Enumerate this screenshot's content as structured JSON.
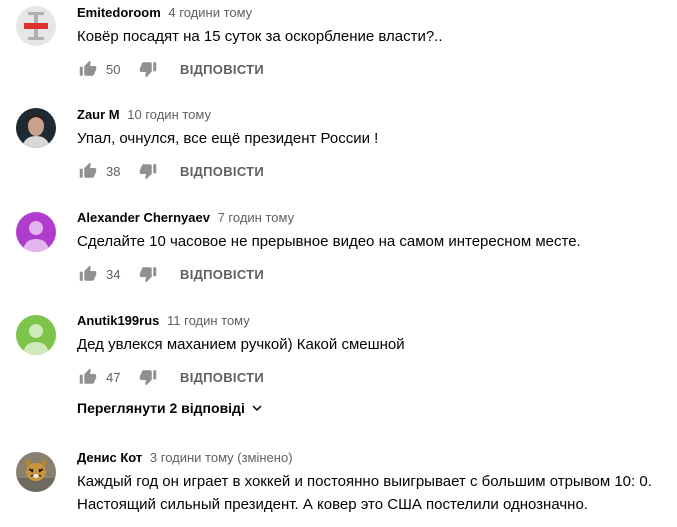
{
  "comments": [
    {
      "author": "Emitedoroom",
      "time": "4 години тому",
      "text": "Ковёр посадят на 15 суток за оскорбление власти?..",
      "likes": "50",
      "reply_label": "ВІДПОВІСТИ",
      "avatar_icon": "logo-avatar",
      "avatar_color": "#d9d9d9"
    },
    {
      "author": "Zaur M",
      "time": "10 годин тому",
      "text": "Упал, очнулся, все ещё президент России !",
      "likes": "38",
      "reply_label": "ВІДПОВІСТИ",
      "avatar_icon": "photo-avatar",
      "avatar_color": "#1d2a33"
    },
    {
      "author": "Alexander Chernyaev",
      "time": "7 годин тому",
      "text": "Сделайте 10 часовое не прерывное видео на самом интересном месте.",
      "likes": "34",
      "reply_label": "ВІДПОВІСТИ",
      "avatar_icon": "default-user-avatar",
      "avatar_color": "#b03ccd"
    },
    {
      "author": "Anutik199rus",
      "time": "11 годин тому",
      "text": "Дед увлекся маханием ручкой) Какой смешной",
      "likes": "47",
      "reply_label": "ВІДПОВІСТИ",
      "avatar_icon": "default-user-avatar",
      "avatar_color": "#7cc44a"
    },
    {
      "author": "Денис Кот",
      "time": "3 години тому (змінено)",
      "text": "Каждый год он играет в хоккей и постоянно выигрывает с большим отрывом 10: 0. Настоящий сильный президент. А ковер это США постелили однозначно.",
      "avatar_icon": "tiger-photo-avatar",
      "avatar_color": "#8a8070"
    }
  ],
  "view_replies_label": "Переглянути 2 відповіді",
  "colors": {
    "text": "#030303",
    "secondary": "#606060"
  }
}
